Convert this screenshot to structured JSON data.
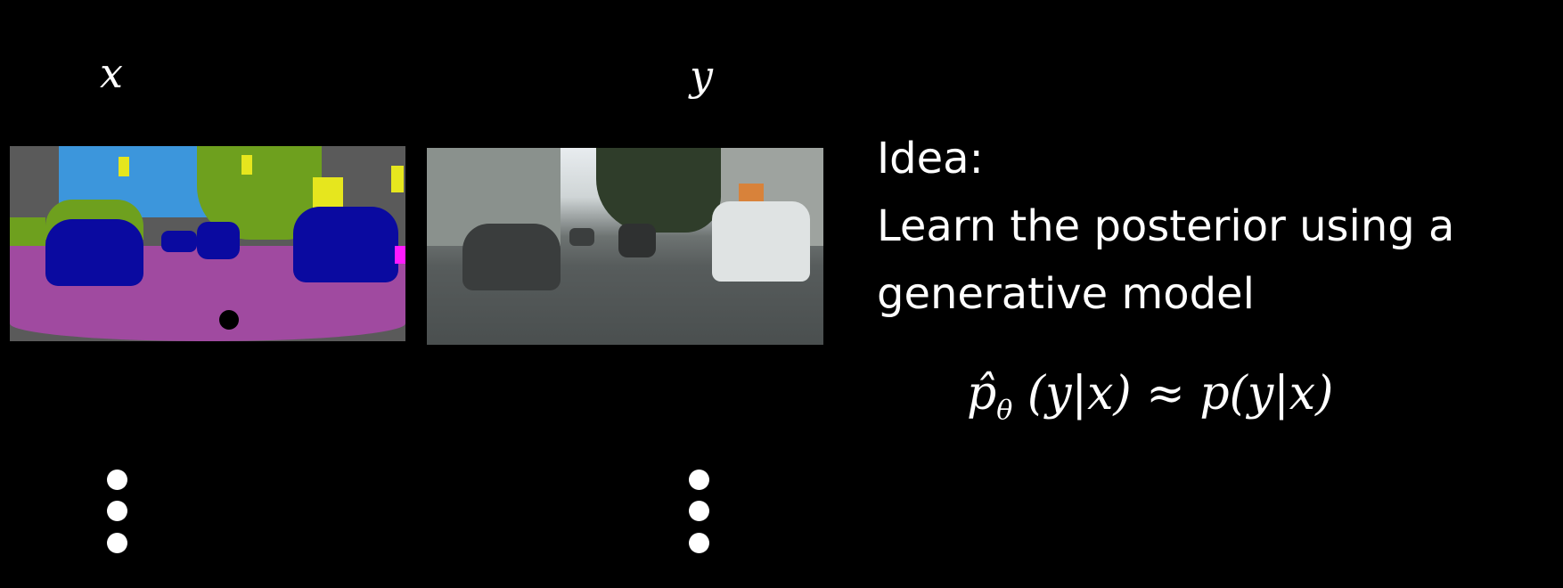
{
  "labels": {
    "input": "x",
    "output": "y"
  },
  "images": {
    "input": {
      "icon": "segmentation-map-image"
    },
    "output": {
      "icon": "street-scene-photo"
    }
  },
  "text": {
    "line1": "Idea:",
    "line2": "Learn the posterior using a",
    "line3": "generative model"
  },
  "formula": {
    "lhs": "p̂",
    "lhs_sub": "θ",
    "lhs_args": " (y|x)",
    "approx": " ≈ ",
    "rhs": "p(y|x)"
  },
  "colors": {
    "road": "#a04aa0",
    "car": "#0a0aa0",
    "vegetation": "#6ea01e",
    "sky": "#3c96dc",
    "sign": "#e6e61e",
    "building": "#5a5a5a"
  }
}
